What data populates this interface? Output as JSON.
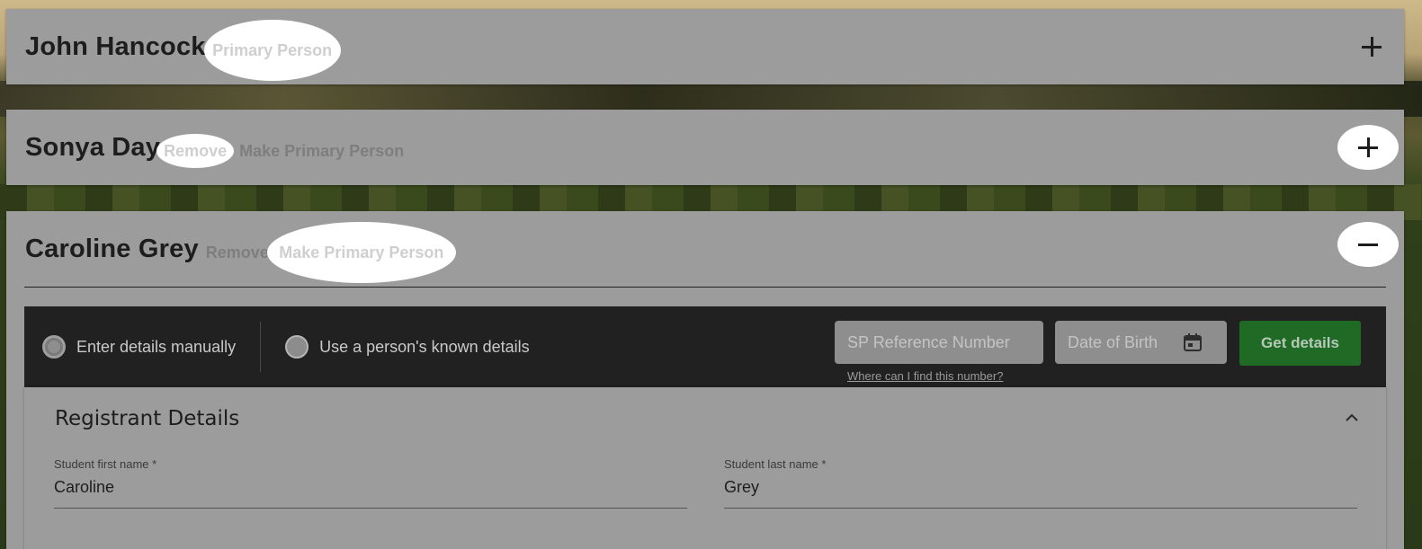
{
  "persons": [
    {
      "name": "John Hancock",
      "primary_badge": "Primary Person"
    },
    {
      "name": "Sonya Day",
      "remove_label": "Remove",
      "make_primary_label": "Make Primary Person"
    },
    {
      "name": "Caroline Grey",
      "remove_label": "Remove",
      "make_primary_label": "Make Primary Person"
    }
  ],
  "lookup": {
    "option_manual": "Enter details manually",
    "option_known": "Use a person's known details",
    "sp_reference_placeholder": "SP Reference Number",
    "dob_placeholder": "Date of Birth",
    "help_link": "Where can I find this number?",
    "get_details_label": "Get details",
    "selected_option": "Enter details manually"
  },
  "registrant": {
    "title": "Registrant Details",
    "first_name_label": "Student first name *",
    "first_name_value": "Caroline",
    "last_name_label": "Student last name *",
    "last_name_value": "Grey"
  },
  "colors": {
    "panel_bg": "#9c9c9c",
    "dark_bar": "#212121",
    "get_details_btn": "#1f6b25",
    "highlight": "#ffffff"
  }
}
